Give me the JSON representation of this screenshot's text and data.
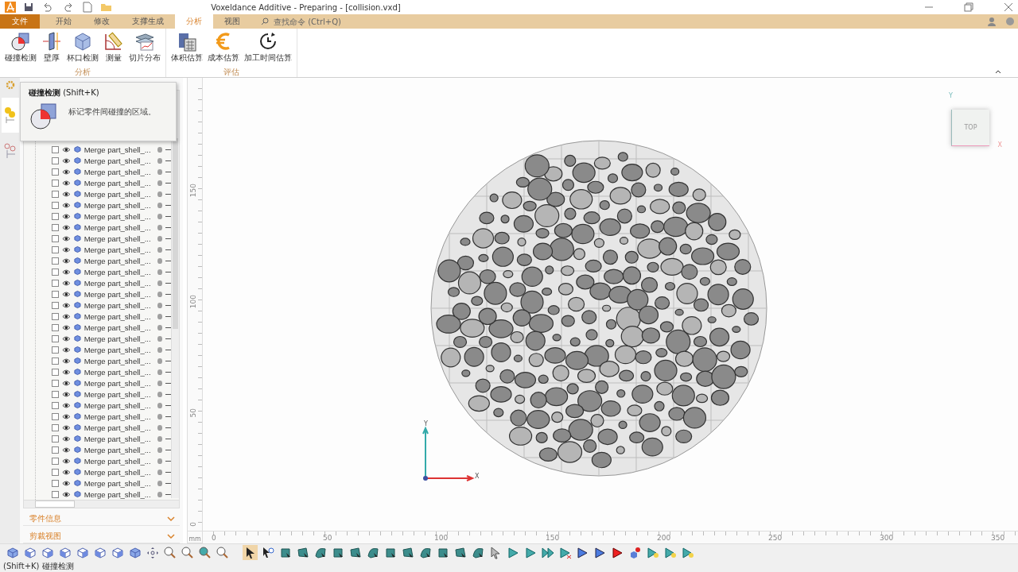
{
  "window": {
    "title": "Voxeldance Additive - Preparing - [collision.vxd]"
  },
  "tabs": [
    {
      "label": "文件",
      "kind": "file",
      "selected": false
    },
    {
      "label": "开始",
      "kind": "tab",
      "selected": false
    },
    {
      "label": "修改",
      "kind": "tab",
      "selected": false
    },
    {
      "label": "支撑生成",
      "kind": "tab",
      "selected": false
    },
    {
      "label": "分析",
      "kind": "tab",
      "selected": true
    },
    {
      "label": "视图",
      "kind": "tab",
      "selected": false
    }
  ],
  "search": {
    "placeholder": "查找命令 (Ctrl+Q)"
  },
  "ribbon_groups": [
    {
      "title": "分析",
      "buttons": [
        {
          "label": "碰撞检测",
          "kind": "collision"
        },
        {
          "label": "壁厚",
          "kind": "thickness"
        },
        {
          "label": "杯口检测",
          "kind": "cup"
        },
        {
          "label": "测量",
          "kind": "measure"
        },
        {
          "label": "切片分布",
          "kind": "slices"
        }
      ]
    },
    {
      "title": "评估",
      "buttons": [
        {
          "label": "体积估算",
          "kind": "volume"
        },
        {
          "label": "成本估算",
          "kind": "cost"
        },
        {
          "label": "加工时间估算",
          "kind": "time"
        }
      ]
    }
  ],
  "tooltip": {
    "title": "碰撞检测",
    "shortcut": "(Shift+K)",
    "description": "标记零件间碰撞的区域。"
  },
  "tree": {
    "rows": [
      {
        "name": "Merge part_shell_...",
        "checked": false,
        "visible": true
      },
      {
        "name": "Merge part_shell_...",
        "checked": false,
        "visible": true
      },
      {
        "name": "Merge part_shell_...",
        "checked": false,
        "visible": true
      },
      {
        "name": "Merge part_shell_...",
        "checked": false,
        "visible": true
      },
      {
        "name": "Merge part_shell_...",
        "checked": false,
        "visible": true
      },
      {
        "name": "Merge part_shell_...",
        "checked": false,
        "visible": true
      },
      {
        "name": "Merge part_shell_...",
        "checked": false,
        "visible": true
      },
      {
        "name": "Merge part_shell_...",
        "checked": false,
        "visible": true
      },
      {
        "name": "Merge part_shell_...",
        "checked": false,
        "visible": true
      },
      {
        "name": "Merge part_shell_...",
        "checked": false,
        "visible": true
      },
      {
        "name": "Merge part_shell_...",
        "checked": false,
        "visible": true
      },
      {
        "name": "Merge part_shell_...",
        "checked": false,
        "visible": true
      },
      {
        "name": "Merge part_shell_...",
        "checked": false,
        "visible": true
      },
      {
        "name": "Merge part_shell_...",
        "checked": false,
        "visible": true
      },
      {
        "name": "Merge part_shell_...",
        "checked": false,
        "visible": true
      },
      {
        "name": "Merge part_shell_...",
        "checked": false,
        "visible": true
      },
      {
        "name": "Merge part_shell_...",
        "checked": false,
        "visible": true
      },
      {
        "name": "Merge part_shell_...",
        "checked": false,
        "visible": true
      },
      {
        "name": "Merge part_shell_...",
        "checked": false,
        "visible": true
      },
      {
        "name": "Merge part_shell_...",
        "checked": false,
        "visible": true
      },
      {
        "name": "Merge part_shell_...",
        "checked": false,
        "visible": true
      },
      {
        "name": "Merge part_shell_...",
        "checked": false,
        "visible": true
      },
      {
        "name": "Merge part_shell_...",
        "checked": false,
        "visible": true
      },
      {
        "name": "Merge part_shell_...",
        "checked": false,
        "visible": true
      },
      {
        "name": "Merge part_shell_...",
        "checked": false,
        "visible": true
      },
      {
        "name": "Merge part_shell_...",
        "checked": false,
        "visible": true
      },
      {
        "name": "Merge part_shell_...",
        "checked": false,
        "visible": true
      },
      {
        "name": "Merge part_shell_...",
        "checked": false,
        "visible": true
      },
      {
        "name": "Merge part_shell_...",
        "checked": false,
        "visible": true
      },
      {
        "name": "Merge part_shell_...",
        "checked": false,
        "visible": true
      },
      {
        "name": "Merge part_shell_...",
        "checked": false,
        "visible": true
      },
      {
        "name": "Merge part_shell_...",
        "checked": false,
        "visible": true
      }
    ]
  },
  "panels": [
    {
      "title": "零件信息",
      "expanded": false
    },
    {
      "title": "剪裁视图",
      "expanded": false
    }
  ],
  "rulers": {
    "unit": "mm",
    "vertical": [
      "150",
      "100",
      "50",
      "0"
    ],
    "horizontal": [
      "0",
      "50",
      "100",
      "150",
      "200",
      "250",
      "300",
      "350"
    ]
  },
  "view_cube": {
    "face": "TOP",
    "x_label": "X",
    "y_label": "Y"
  },
  "axes": {
    "x_label": "X",
    "y_label": "Y"
  },
  "select_tools": [
    {
      "kind": "pointer",
      "selected": true
    },
    {
      "kind": "pointer-sphere",
      "selected": false
    },
    {
      "kind": "face",
      "selected": false
    },
    {
      "kind": "face",
      "selected": false
    },
    {
      "kind": "face",
      "selected": false
    },
    {
      "kind": "face",
      "selected": false
    },
    {
      "kind": "face",
      "selected": false
    },
    {
      "kind": "face",
      "selected": false
    },
    {
      "kind": "face",
      "selected": false
    },
    {
      "kind": "face",
      "selected": false
    },
    {
      "kind": "face",
      "selected": false
    },
    {
      "kind": "face",
      "selected": false
    },
    {
      "kind": "face",
      "selected": false
    },
    {
      "kind": "face",
      "selected": false
    },
    {
      "kind": "pointer-grey",
      "selected": false
    },
    {
      "kind": "play",
      "selected": false
    },
    {
      "kind": "play",
      "selected": false
    },
    {
      "kind": "play-double",
      "selected": false
    },
    {
      "kind": "play-stop",
      "selected": false
    },
    {
      "kind": "play-blue",
      "selected": false
    },
    {
      "kind": "play-blue",
      "selected": false
    },
    {
      "kind": "play-red",
      "selected": false
    },
    {
      "kind": "cube-add",
      "selected": false
    },
    {
      "kind": "bulb-play",
      "selected": false
    },
    {
      "kind": "bulb-play",
      "selected": false
    },
    {
      "kind": "bulb-play",
      "selected": false
    }
  ],
  "status_bar": {
    "text": "(Shift+K) 碰撞检测"
  }
}
